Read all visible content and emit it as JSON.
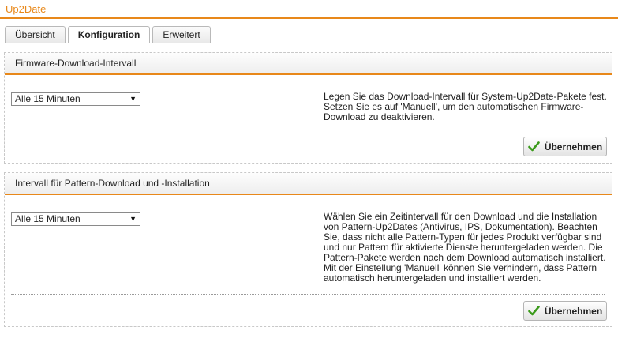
{
  "app": {
    "title": "Up2Date"
  },
  "tabs": [
    {
      "label": "Übersicht",
      "active": false
    },
    {
      "label": "Konfiguration",
      "active": true
    },
    {
      "label": "Erweitert",
      "active": false
    }
  ],
  "panels": [
    {
      "title": "Firmware-Download-Intervall",
      "select_value": "Alle 15 Minuten",
      "description": "Legen Sie das Download-Intervall für System-Up2Date-Pakete fest. Setzen Sie es auf 'Manuell', um den automatischen Firmware-Download zu deaktivieren.",
      "apply_label": "Übernehmen"
    },
    {
      "title": "Intervall für Pattern-Download und -Installation",
      "select_value": "Alle 15 Minuten",
      "description": "Wählen Sie ein Zeitintervall für den Download und die Installation von Pattern-Up2Dates (Antivirus, IPS, Dokumentation). Beachten Sie, dass nicht alle Pattern-Typen für jedes Produkt verfügbar sind und nur Pattern für aktivierte Dienste heruntergeladen werden. Die Pattern-Pakete werden nach dem Download automatisch installiert. Mit der Einstellung 'Manuell' können Sie verhindern, dass Pattern automatisch heruntergeladen und installiert werden.",
      "apply_label": "Übernehmen"
    }
  ],
  "colors": {
    "accent": "#e8881a",
    "check": "#3a9a1a"
  },
  "icons": {
    "apply": "checkmark-icon",
    "dropdown": "chevron-down-icon"
  }
}
